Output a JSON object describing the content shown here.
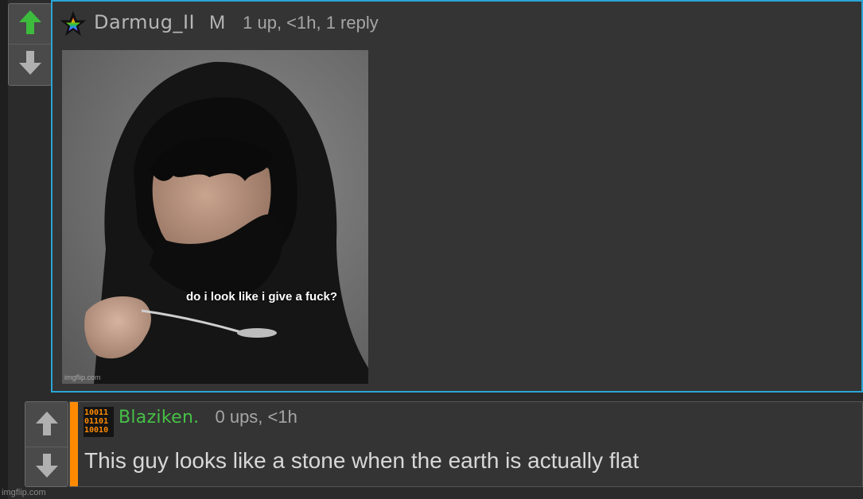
{
  "top_comment": {
    "username": "Darmug_II",
    "gender": "M",
    "meta": "1 up, <1h, 1 reply",
    "image": {
      "caption": "do i look like i give a fuck?",
      "watermark": "imgflip.com"
    }
  },
  "reply_comment": {
    "username": "Blaziken.",
    "meta": "0 ups, <1h",
    "text": "This guy looks like a stone when the earth is actually flat"
  },
  "footer": {
    "watermark": "imgflip.com"
  },
  "colors": {
    "accent_border": "#2aa5d5",
    "upvote_active": "#3dbb3d",
    "reply_bar": "#ff8a00",
    "reply_username": "#46c146"
  }
}
